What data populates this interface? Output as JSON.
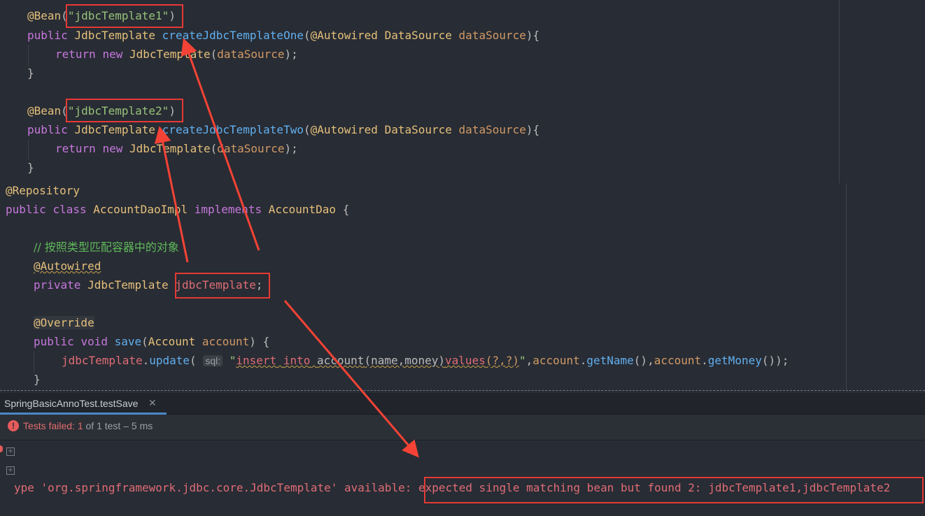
{
  "editor_top": {
    "bean1_annotation": "@Bean",
    "bean1_open": "(",
    "bean1_name": "\"jdbcTemplate1\"",
    "bean1_close": ")",
    "m1_public": "public",
    "m1_type": "JdbcTemplate",
    "m1_name": "createJdbcTemplateOne",
    "m1_open": "(",
    "m1_autowired": "@Autowired",
    "m1_ptype": "DataSource",
    "m1_pname": "dataSource",
    "m1_close": "){",
    "r1_return": "return",
    "r1_new": "new",
    "r1_type": "JdbcTemplate",
    "r1_open": "(",
    "r1_arg": "dataSource",
    "r1_close": ");",
    "brace1": "}",
    "bean2_annotation": "@Bean",
    "bean2_open": "(",
    "bean2_name": "\"jdbcTemplate2\"",
    "bean2_close": ")",
    "m2_public": "public",
    "m2_type": "JdbcTemplate",
    "m2_name": "createJdbcTemplateTwo",
    "m2_open": "(",
    "m2_autowired": "@Autowired",
    "m2_ptype": "DataSource",
    "m2_pname": "dataSource",
    "m2_close": "){",
    "r2_return": "return",
    "r2_new": "new",
    "r2_type": "JdbcTemplate",
    "r2_open": "(",
    "r2_arg": "dataSource",
    "r2_close": ");",
    "brace2": "}"
  },
  "editor_bottom": {
    "repository": "@Repository",
    "cls_public": "public",
    "cls_class": "class",
    "cls_name": "AccountDaoImpl",
    "cls_implements": "implements",
    "cls_iface": "AccountDao",
    "cls_brace": "{",
    "comment": "// 按照类型匹配容器中的对象",
    "autowired": "@Autowired",
    "f_private": "private",
    "f_type": "JdbcTemplate",
    "f_name": "jdbcTemplate",
    "f_semicolon": ";",
    "override": "@Override",
    "s_public": "public",
    "s_void": "void",
    "s_name": "save",
    "s_open": "(",
    "s_ptype": "Account",
    "s_pname": "account",
    "s_close": ") {",
    "u_field": "jdbcTemplate",
    "u_dot": ".",
    "u_method": "update",
    "u_open": "(",
    "u_hint": "sql:",
    "u_quote_open": "\"",
    "u_sql_insert": "insert",
    "u_sql_into": "into",
    "u_sql_table": "account",
    "u_sql_cols": "(name,money)",
    "u_sql_values": "values",
    "u_sql_params": "(?,?)",
    "u_quote_close": "\"",
    "u_comma1": ",",
    "u_acc1": "account",
    "u_dot1": ".",
    "u_getname": "getName",
    "u_call1": "(),",
    "u_acc2": "account",
    "u_dot2": ".",
    "u_getmoney": "getMoney",
    "u_call2": "());",
    "s_brace": "}"
  },
  "run_tab": {
    "label": "SpringBasicAnnoTest.testSave",
    "close_icon": "close-icon"
  },
  "status": {
    "failed_label": "Tests failed:",
    "failed_count": "1",
    "of_text": "of 1 test",
    "sep": "–",
    "duration": "5 ms"
  },
  "console": {
    "prefix": "ype 'org.springframework.jdbc.core.JdbcTemplate' available:",
    "highlight": "expected single matching bean but found 2: jdbcTemplate1,jdbcTemplate2"
  },
  "colors": {
    "annotation_box": "#e53935",
    "arrow": "#f44336"
  }
}
